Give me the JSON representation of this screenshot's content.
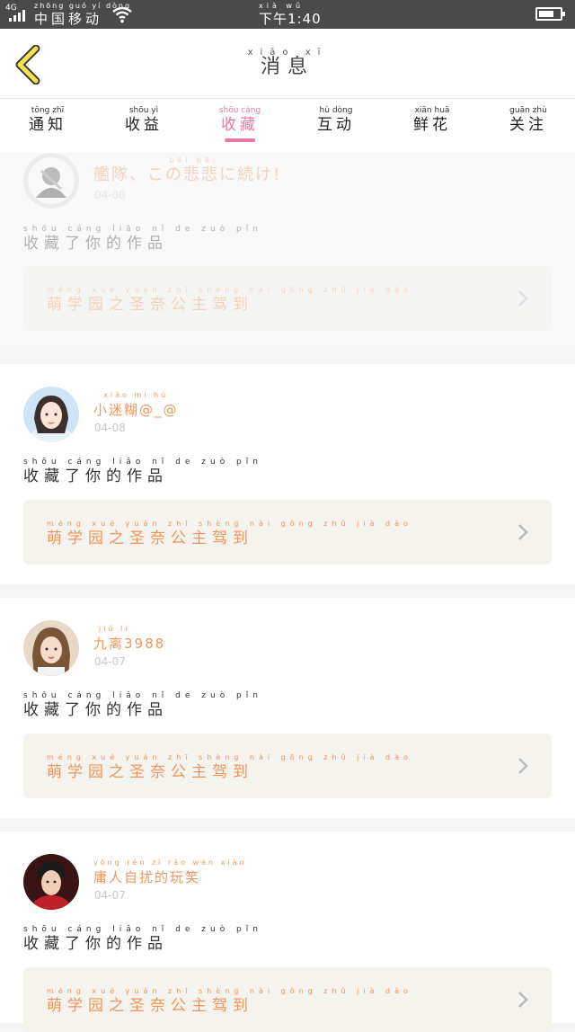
{
  "status_bar": {
    "network": "4G",
    "carrier_pinyin": "zhōng guó yí dòng",
    "carrier": "中国移动",
    "time_pinyin": "xià wǔ",
    "time": "下午1:40"
  },
  "header": {
    "title_pinyin": "xiāo xī",
    "title": "消息"
  },
  "tabs": [
    {
      "pinyin": "tōng zhī",
      "label": "通知"
    },
    {
      "pinyin": "shōu yì",
      "label": "收益"
    },
    {
      "pinyin": "shōu cáng",
      "label": "收藏"
    },
    {
      "pinyin": "hù dòng",
      "label": "互动"
    },
    {
      "pinyin": "xiān huā",
      "label": "鲜花"
    },
    {
      "pinyin": "guān zhù",
      "label": "关注"
    }
  ],
  "active_tab": "收藏",
  "accent_color": "#e779a8",
  "name_color": "#f0955c",
  "messages": [
    {
      "user_pinyin": "bēi bēi",
      "user": "艦隊、この悲悲に続け!",
      "date": "04-08",
      "action_pinyin": "shōu cáng liǎo nǐ de zuò pǐn",
      "action": "收藏了你的作品",
      "work_pinyin": "méng xué yuán zhī shèng nài gōng zhǔ jià dào",
      "work": "萌学园之圣奈公主驾到",
      "avatar_icon": "anime-avatar"
    },
    {
      "user_pinyin": "xiǎo mí hú",
      "user": "小迷糊@_@",
      "date": "04-08",
      "action_pinyin": "shōu cáng liǎo nǐ de zuò pǐn",
      "action": "收藏了你的作品",
      "work_pinyin": "méng xué yuán zhī shèng nài gōng zhǔ jià dào",
      "work": "萌学园之圣奈公主驾到",
      "avatar_icon": "girl-avatar"
    },
    {
      "user_pinyin": "jiǔ lí",
      "user": "九离3988",
      "date": "04-07",
      "action_pinyin": "shōu cáng liǎo nǐ de zuò pǐn",
      "action": "收藏了你的作品",
      "work_pinyin": "méng xué yuán zhī shèng nài gōng zhǔ jià dào",
      "work": "萌学园之圣奈公主驾到",
      "avatar_icon": "girl-photo-avatar"
    },
    {
      "user_pinyin": "yōng rén zì rǎo wán xiào",
      "user": "庸人自扰的玩笑",
      "date": "04-07",
      "action_pinyin": "shōu cáng liǎo nǐ de zuò pǐn",
      "action": "收藏了你的作品",
      "work_pinyin": "méng xué yuán zhī shèng nài gōng zhǔ jià dào",
      "work": "萌学园之圣奈公主驾到",
      "avatar_icon": "boy-photo-avatar"
    }
  ]
}
